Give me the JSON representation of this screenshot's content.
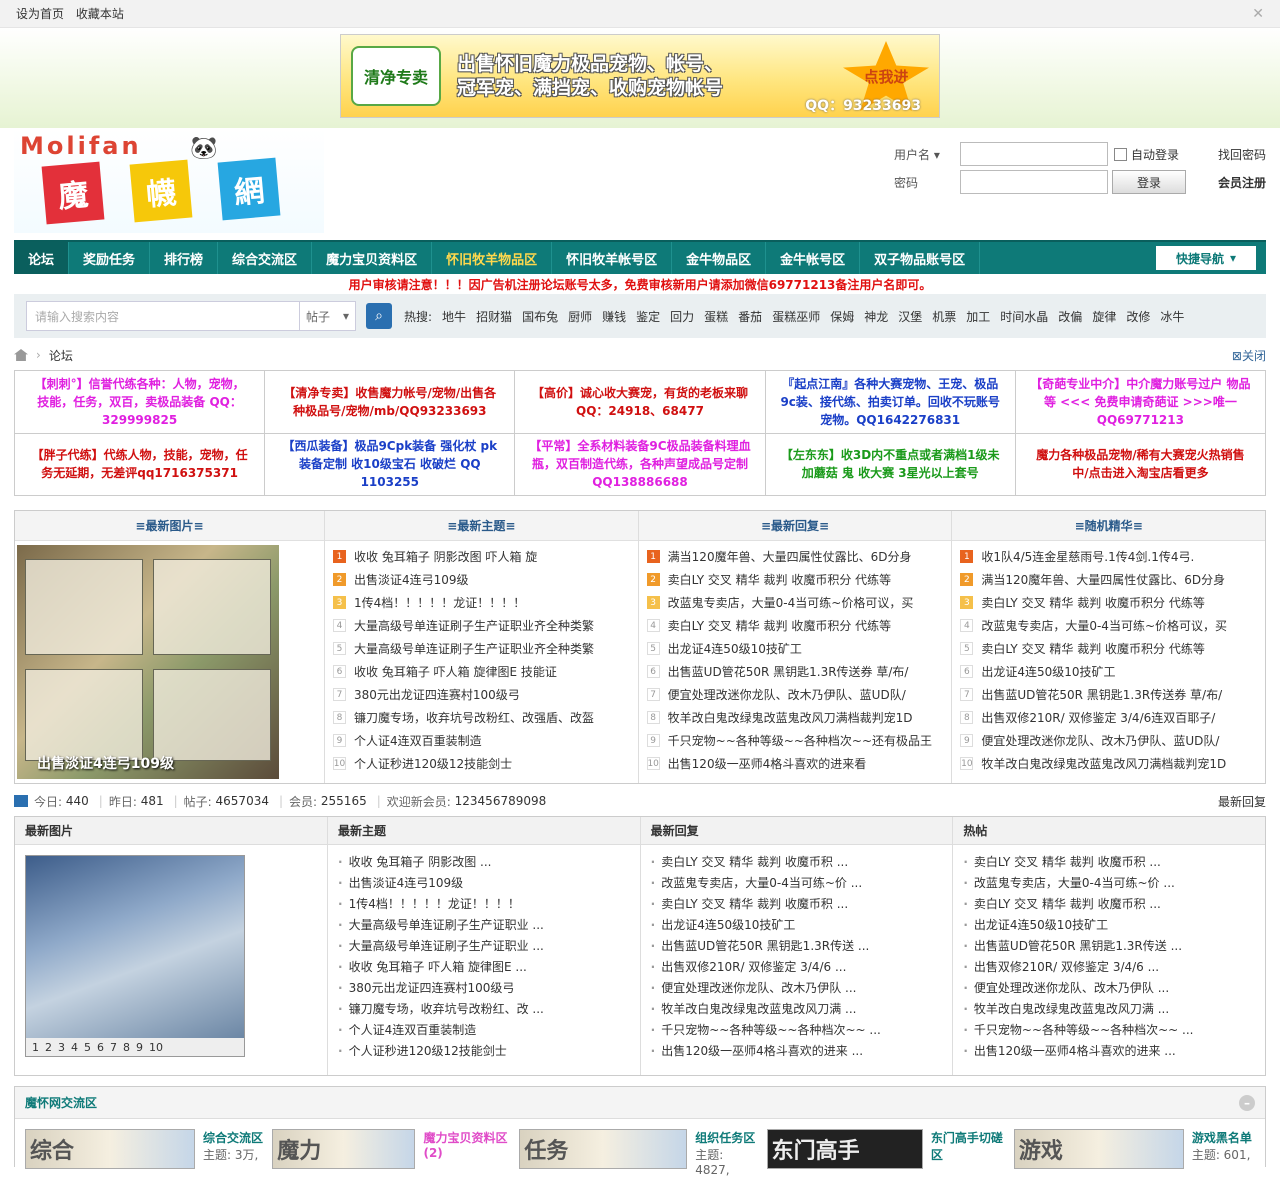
{
  "topbar": {
    "set_home": "设为首页",
    "bookmark": "收藏本站",
    "close_icon": "close-icon"
  },
  "banner": {
    "tag": "清净专卖",
    "line1": "出售怀旧魔力极品宠物、帐号、",
    "line2": "冠军宠、满挡宠、收购宠物帐号",
    "button": "点我进",
    "qq": "QQ：93233693"
  },
  "logo": {
    "brand": "Molifan",
    "c1": "魔",
    "c2": "幭",
    "c3": "網"
  },
  "login": {
    "username_label": "用户名",
    "password_label": "密码",
    "auto_login": "自动登录",
    "submit": "登录",
    "find_password": "找回密码",
    "register": "会员注册"
  },
  "nav": {
    "items": [
      "论坛",
      "奖励任务",
      "排行榜",
      "综合交流区",
      "魔力宝贝资料区",
      "怀旧牧羊物品区",
      "怀旧牧羊帐号区",
      "金牛物品区",
      "金牛帐号区",
      "双子物品账号区"
    ],
    "quick": "快捷导航"
  },
  "notice": "用户审核请注意！！！因广告机注册论坛账号太多，免费审核新用户请添加微信69771213备注用户名即可。",
  "search": {
    "placeholder": "请输入搜索内容",
    "type": "帖子",
    "hot_label": "热搜:",
    "hot": [
      "地牛",
      "招财猫",
      "国布兔",
      "厨师",
      "赚钱",
      "鉴定",
      "回力",
      "蛋糕",
      "番茄",
      "蛋糕巫师",
      "保姆",
      "神龙",
      "汉堡",
      "机票",
      "加工",
      "时间水晶",
      "改偏",
      "旋律",
      "改修",
      "冰牛"
    ]
  },
  "breadcrumb": {
    "current": "论坛",
    "close": "关闭"
  },
  "ads": [
    {
      "text": "【刺刺°】信誉代练各种：人物，宠物，技能，任务，双百，卖极品装备 QQ：329999825",
      "color": "#e020e0"
    },
    {
      "text": "【清净专卖】收售魔力帐号/宠物/出售各种极品号/宠物/mb/QQ93233693",
      "color": "#d01010"
    },
    {
      "text": "【高价】诚心收大赛宠，有货的老板来聊 QQ：24918、68477",
      "color": "#d01010"
    },
    {
      "text": "『起点江南』各种大赛宠物、王宠、极品9c装、接代练、拍卖订单。回收不玩账号宠物。QQ1642276831",
      "color": "#1a3fc7"
    },
    {
      "text": "【奇葩专业中介】中介魔力账号过户 物品等 <<< 免费申请奇葩证 >>>唯一QQ69771213",
      "color": "#e020e0"
    },
    {
      "text": "【胖子代练】代练人物，技能，宠物，任务无延期，无差评qq1716375371",
      "color": "#d01010"
    },
    {
      "text": "【西瓜装备】极品9Cpk装备 强化杖 pk装备定制 收10级宝石 收破烂 QQ 1103255",
      "color": "#1a3fc7"
    },
    {
      "text": "【平常】全系材料装备9C极品装备料理血瓶，双百制造代练，各种声望成品号定制QQ138886688",
      "color": "#e020e0"
    },
    {
      "text": "【左东东】收3D内不重点或者满档1级未加蘑菇 鬼 收大赛 3星光以上套号",
      "color": "#1a9a1a"
    },
    {
      "text": "魔力各种极品宠物/稀有大赛宠火热销售中/点击进入淘宝店看更多",
      "color": "#d01010"
    }
  ],
  "panel1": {
    "h_pics": "最新图片",
    "h_topics": "最新主题",
    "h_replies": "最新回复",
    "h_best": "随机精华",
    "pic_caption": "出售淡证4连弓109级",
    "topics": [
      "收收 兔耳箱子 阴影改图 吓人箱 旋",
      "出售淡证4连弓109级",
      "1传4档！！！！！龙证！！！！",
      "大量高级号单连证刷子生产证职业齐全种类繁",
      "大量高级号单连证刷子生产证职业齐全种类繁",
      "收收 兔耳箱子 吓人箱 旋律图E 技能证",
      "380元出龙证四连赛村100级弓",
      "镰刀魔专场，收弃坑号改粉红、改强盾、改盔",
      "个人证4连双百重装制造",
      "个人证秒进120级12技能剑士"
    ],
    "replies": [
      "满当120魔年兽、大量四属性仗露比、6D分身",
      "卖白LY 交叉 精华 裁判 收魔币积分 代练等",
      "改蓝鬼专卖店，大量0-4当可练~价格可议，买",
      "卖白LY 交叉 精华 裁判 收魔币积分 代练等",
      "出龙证4连50级10技矿工",
      "出售蓝UD管花50R 黑钥匙1.3R传送券 草/布/",
      "便宜处理改迷你龙队、改木乃伊队、蓝UD队/",
      "牧羊改白鬼改绿鬼改蓝鬼改风刀满档裁判宠1D",
      "千只宠物~~各种等级~~各种档次~~还有极品王",
      "出售120级一巫师4格斗喜欢的进来看"
    ],
    "best": [
      "收1队4/5连金星慈雨号.1传4剑.1传4弓.",
      "满当120魔年兽、大量四属性仗露比、6D分身",
      "卖白LY 交叉 精华 裁判 收魔币积分 代练等",
      "改蓝鬼专卖店，大量0-4当可练~价格可议，买",
      "卖白LY 交叉 精华 裁判 收魔币积分 代练等",
      "出龙证4连50级10技矿工",
      "出售蓝UD管花50R 黑钥匙1.3R传送券 草/布/",
      "出售双修210R/ 双修鉴定 3/4/6连双百耶子/",
      "便宜处理改迷你龙队、改木乃伊队、蓝UD队/",
      "牧羊改白鬼改绿鬼改蓝鬼改风刀满档裁判宠1D"
    ]
  },
  "stats": {
    "today_label": "今日:",
    "today": "440",
    "yesterday_label": "昨日:",
    "yesterday": "481",
    "posts_label": "帖子:",
    "posts": "4657034",
    "members_label": "会员:",
    "members": "255165",
    "welcome_label": "欢迎新会员:",
    "newest": "123456789098",
    "latest_reply": "最新回复"
  },
  "panel2": {
    "h_pics": "最新图片",
    "h_topics": "最新主题",
    "h_replies": "最新回复",
    "h_hot": "热帖",
    "pager": [
      "1",
      "2",
      "3",
      "4",
      "5",
      "6",
      "7",
      "8",
      "9",
      "10"
    ],
    "topics": [
      "收收 兔耳箱子 阴影改图 ...",
      "出售淡证4连弓109级",
      "1传4档！！！！！龙证！！！！",
      "大量高级号单连证刷子生产证职业 ...",
      "大量高级号单连证刷子生产证职业 ...",
      "收收 兔耳箱子 吓人箱 旋律图E ...",
      "380元出龙证四连赛村100级弓",
      "镰刀魔专场，收弃坑号改粉红、改 ...",
      "个人证4连双百重装制造",
      "个人证秒进120级12技能剑士"
    ],
    "replies": [
      "卖白LY 交叉 精华 裁判 收魔币积 ...",
      "改蓝鬼专卖店，大量0-4当可练~价 ...",
      "卖白LY 交叉 精华 裁判 收魔币积 ...",
      "出龙证4连50级10技矿工",
      "出售蓝UD管花50R 黑钥匙1.3R传送 ...",
      "出售双修210R/ 双修鉴定 3/4/6 ...",
      "便宜处理改迷你龙队、改木乃伊队 ...",
      "牧羊改白鬼改绿鬼改蓝鬼改风刀满 ...",
      "千只宠物~~各种等级~~各种档次~~ ...",
      "出售120级一巫师4格斗喜欢的进来 ..."
    ],
    "hot": [
      "卖白LY 交叉 精华 裁判 收魔币积 ...",
      "改蓝鬼专卖店，大量0-4当可练~价 ...",
      "卖白LY 交叉 精华 裁判 收魔币积 ...",
      "出龙证4连50级10技矿工",
      "出售蓝UD管花50R 黑钥匙1.3R传送 ...",
      "出售双修210R/ 双修鉴定 3/4/6 ...",
      "便宜处理改迷你龙队、改木乃伊队 ...",
      "牧羊改白鬼改绿鬼改蓝鬼改风刀满 ...",
      "千只宠物~~各种等级~~各种档次~~ ...",
      "出售120级一巫师4格斗喜欢的进来 ..."
    ]
  },
  "zone": {
    "title": "魔怀网交流区",
    "items": [
      {
        "thumb": "综合",
        "name": "综合交流区",
        "sub": "主题: 3万,"
      },
      {
        "thumb": "魔力",
        "name": "魔力宝贝资料区 (2)",
        "sub": ""
      },
      {
        "thumb": "任务",
        "name": "组织任务区",
        "sub": "主题: 4827,"
      },
      {
        "thumb": "东门高手",
        "name": "东门高手切磋区",
        "sub": ""
      },
      {
        "thumb": "游戏",
        "name": "游戏黑名单",
        "sub": "主题: 601,"
      }
    ]
  }
}
